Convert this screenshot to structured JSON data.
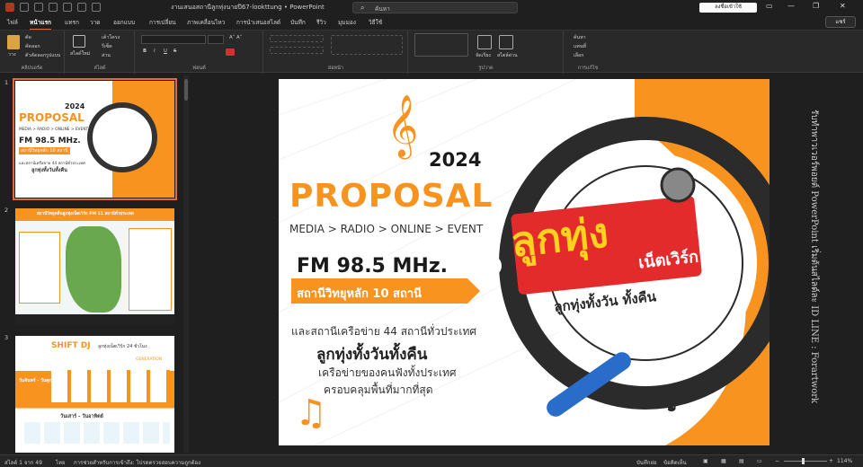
{
  "titlebar": {
    "autosave": "",
    "doc_title": "งานเสนอสถานีลูกทุ่งนายปี67-lookttung  •  PowerPoint",
    "search_placeholder": "ค้นหา",
    "signin_label": "ลงชื่อเข้าใช้"
  },
  "tabs": {
    "items": [
      "ไฟล์",
      "หน้าแรก",
      "แทรก",
      "วาด",
      "ออกแบบ",
      "การเปลี่ยน",
      "ภาพเคลื่อนไหว",
      "การนำเสนอสไลด์",
      "บันทึก",
      "รีวิว",
      "มุมมอง",
      "วิธีใช้"
    ],
    "active_index": 1,
    "share_label": "แชร์"
  },
  "ribbon": {
    "clipboard": {
      "paste": "วาง",
      "cut": "ตัด",
      "copy": "คัดลอก",
      "format_painter": "ตัวคัดลอกรูปแบบ",
      "label": "คลิปบอร์ด"
    },
    "slides": {
      "new_slide": "สไลด์ใหม่",
      "layout": "เค้าโครง",
      "reset": "รีเซ็ต",
      "section": "ส่วน",
      "label": "สไลด์"
    },
    "font": {
      "label": "ฟอนต์",
      "bold": "B",
      "italic": "I",
      "underline": "U",
      "strike": "S"
    },
    "paragraph": {
      "label": "ย่อหน้า"
    },
    "drawing": {
      "label": "รูปวาด",
      "arrange": "จัดเรียง",
      "quick_styles": "สไตล์ด่วน"
    },
    "editing": {
      "find": "ค้นหา",
      "replace": "แทนที่",
      "select": "เลือก",
      "label": "การแก้ไข"
    }
  },
  "thumbnails": [
    {
      "num": "1",
      "selected": true
    },
    {
      "num": "2",
      "selected": false
    },
    {
      "num": "3",
      "selected": false
    }
  ],
  "thumb1": {
    "year": "2024",
    "title": "PROPOSAL",
    "sub": "MEDIA > RADIO > ONLINE > EVENT",
    "fm": "FM 98.5 MHz.",
    "station": "สถานีวิทยุหลัก 10 สถานี",
    "l1": "และสถานีเครือข่าย 44 สถานีทั่วประเทศ",
    "l2": "ลูกทุ่งทั้งวันทั้งคืน"
  },
  "thumb2": {
    "header": "สถานีวิทยุคลื่นลูกทุ่งเน็ตเวิร์ก FM 11 สถานีทั่วประเทศ"
  },
  "thumb3": {
    "header": "SHIFT DJ",
    "sub": "ลูกทุ่งเน็ตเวิร์ก 24 ชั่วโมง",
    "gen": "GENERATION",
    "day1": "วันจันทร์ - วันศุกร์",
    "day2": "วันเสาร์ - วันอาทิตย์"
  },
  "slide": {
    "year": "2024",
    "title": "PROPOSAL",
    "subtitle": "MEDIA > RADIO > ONLINE > EVENT",
    "fm": "FM 98.5 MHz.",
    "station": "สถานีวิทยุหลัก 10 สถานี",
    "line1": "และสถานีเครือข่าย 44 สถานีทั่วประเทศ",
    "line2": "ลูกทุ่งทั้งวันทั้งคืน",
    "line3": "เครือข่ายของคนฟังทั้งประเทศ",
    "line4": "ครอบคลุมพื้นที่มากที่สุด",
    "logo_main": "ลูกทุ่ง",
    "logo_net": "เน็ตเวิร์ก",
    "logo_slogan": "ลูกทุ่งทั้งวัน ทั้งคืน"
  },
  "notes_vertical": "รับทำพาวเวอร์พอยต์ PowerPoint เริ่มต้นสไลด์ละ ID LINE : Forartwork",
  "status": {
    "slide_info": "สไลด์ 1 จาก 49",
    "lang": "ไทย",
    "accessibility": "การช่วยสำหรับการเข้าถึง: โปรดตรวจสอบความถูกต้อง",
    "notes": "บันทึกย่อ",
    "display": "ข้อคิดเห็น",
    "zoom": "114%"
  },
  "colors": {
    "accent": "#e06b3a",
    "orange": "#f7931e",
    "dark": "#2b2b2b"
  }
}
